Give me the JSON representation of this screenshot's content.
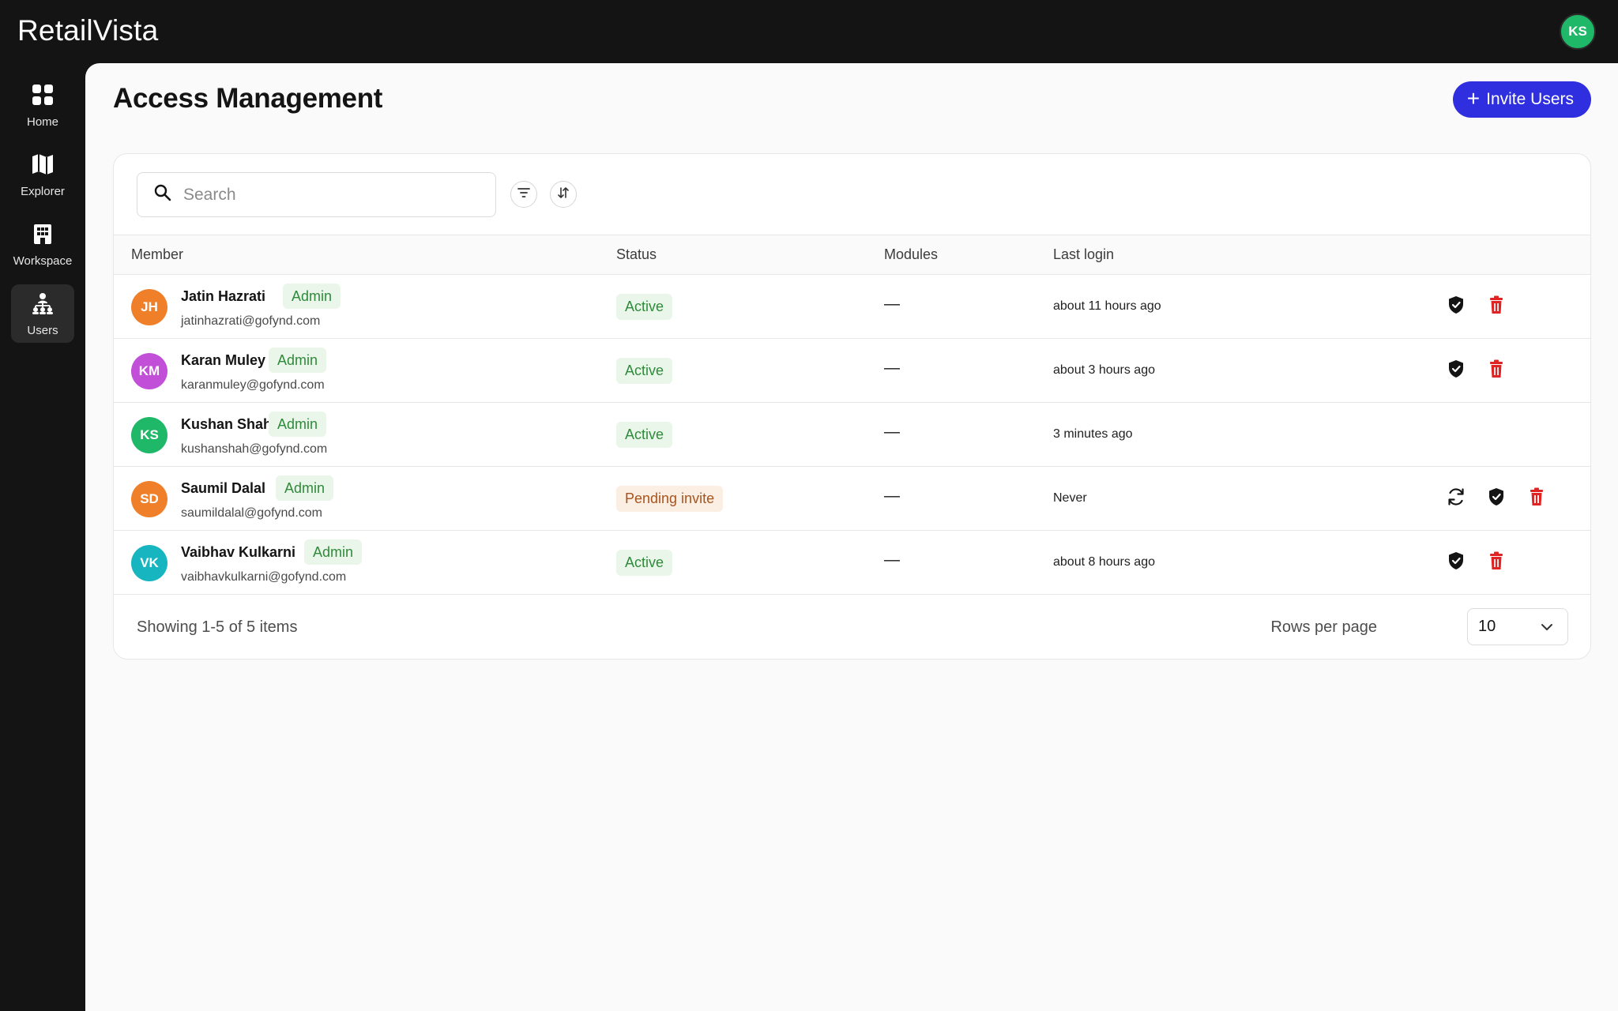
{
  "app": {
    "brand": "RetailVista",
    "user_initials": "KS"
  },
  "sidebar": {
    "items": [
      {
        "label": "Home",
        "icon": "grid-icon",
        "active": false
      },
      {
        "label": "Explorer",
        "icon": "map-icon",
        "active": false
      },
      {
        "label": "Workspace",
        "icon": "building-icon",
        "active": false
      },
      {
        "label": "Users",
        "icon": "users-hierarchy-icon",
        "active": true
      }
    ]
  },
  "page": {
    "title": "Access Management",
    "invite_label": "Invite Users"
  },
  "search": {
    "placeholder": "Search",
    "value": ""
  },
  "table": {
    "columns": [
      "Member",
      "Status",
      "Modules",
      "Last login"
    ],
    "rows": [
      {
        "initials": "JH",
        "avatar_color": "#f07f2a",
        "name": "Jatin Hazrati",
        "role": "Admin",
        "email": "jatinhazrati@gofynd.com",
        "status": "Active",
        "status_kind": "active",
        "modules": "—",
        "last_login": "about 11 hours ago",
        "actions": [
          "shield-icon",
          "trash-icon"
        ]
      },
      {
        "initials": "KM",
        "avatar_color": "#c24fd8",
        "name": "Karan Muley",
        "role": "Admin",
        "email": "karanmuley@gofynd.com",
        "status": "Active",
        "status_kind": "active",
        "modules": "—",
        "last_login": "about 3 hours ago",
        "actions": [
          "shield-icon",
          "trash-icon"
        ]
      },
      {
        "initials": "KS",
        "avatar_color": "#1fb868",
        "name": "Kushan Shah",
        "role": "Admin",
        "email": "kushanshah@gofynd.com",
        "status": "Active",
        "status_kind": "active",
        "modules": "—",
        "last_login": "3 minutes ago",
        "actions": []
      },
      {
        "initials": "SD",
        "avatar_color": "#f07f2a",
        "name": "Saumil Dalal",
        "role": "Admin",
        "email": "saumildalal@gofynd.com",
        "status": "Pending invite",
        "status_kind": "pending",
        "modules": "—",
        "last_login": "Never",
        "actions": [
          "refresh-icon",
          "shield-icon",
          "trash-icon"
        ]
      },
      {
        "initials": "VK",
        "avatar_color": "#17b5c0",
        "name": "Vaibhav Kulkarni",
        "role": "Admin",
        "email": "vaibhavkulkarni@gofynd.com",
        "status": "Active",
        "status_kind": "active",
        "modules": "—",
        "last_login": "about 8 hours ago",
        "actions": [
          "shield-icon",
          "trash-icon"
        ]
      }
    ]
  },
  "footer": {
    "showing": "Showing 1-5 of 5 items",
    "rows_per_page_label": "Rows per page",
    "rows_per_page_value": "10"
  },
  "colors": {
    "accent": "#2f2fe0",
    "danger": "#e02424",
    "success": "#2f8a3a",
    "pending": "#a7541f"
  }
}
